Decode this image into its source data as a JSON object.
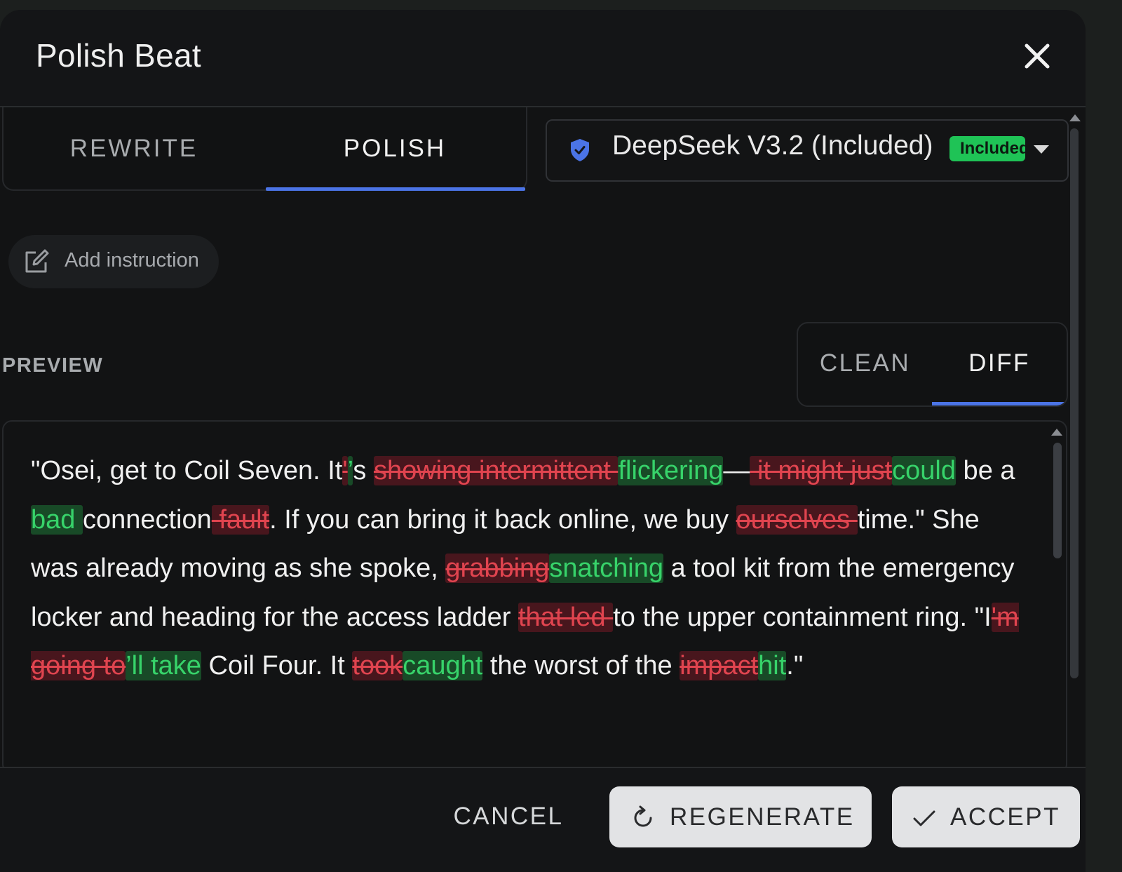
{
  "dialog": {
    "title": "Polish Beat",
    "close_icon": "close-icon"
  },
  "mode_tabs": {
    "items": [
      "REWRITE",
      "POLISH"
    ],
    "active": "POLISH"
  },
  "model": {
    "name": "DeepSeek V3.2 (Included)",
    "badge": "Included",
    "icon": "shield-check-icon",
    "badge_color": "#1fc356"
  },
  "instruction": {
    "label": "Add instruction",
    "icon": "edit-icon"
  },
  "preview": {
    "label": "PREVIEW",
    "view_tabs": [
      "CLEAN",
      "DIFF"
    ],
    "active_view": "DIFF",
    "segments": [
      {
        "t": "eq",
        "s": "\"Osei, get to Coil Seven. It"
      },
      {
        "t": "del",
        "s": "'"
      },
      {
        "t": "ins",
        "s": "’"
      },
      {
        "t": "eq",
        "s": "s "
      },
      {
        "t": "del",
        "s": "showing intermittent "
      },
      {
        "t": "ins",
        "s": "flickering"
      },
      {
        "t": "eq",
        "s": "—"
      },
      {
        "t": "del",
        "s": " it might just"
      },
      {
        "t": "ins",
        "s": "could"
      },
      {
        "t": "eq",
        "s": " be a "
      },
      {
        "t": "ins",
        "s": "bad "
      },
      {
        "t": "eq",
        "s": "connection"
      },
      {
        "t": "del",
        "s": " fault"
      },
      {
        "t": "eq",
        "s": ". If you can bring it back online, we buy "
      },
      {
        "t": "del",
        "s": "ourselves "
      },
      {
        "t": "eq",
        "s": "time.\" She was already moving as she spoke, "
      },
      {
        "t": "del",
        "s": "grabbing"
      },
      {
        "t": "ins",
        "s": "snatching"
      },
      {
        "t": "eq",
        "s": " a tool kit from the emergency locker and heading for the access ladder "
      },
      {
        "t": "del",
        "s": "that led "
      },
      {
        "t": "eq",
        "s": "to the upper containment ring. \"I"
      },
      {
        "t": "del",
        "s": "'m going to"
      },
      {
        "t": "ins",
        "s": "’ll take"
      },
      {
        "t": "eq",
        "s": " Coil Four. It "
      },
      {
        "t": "del",
        "s": "took"
      },
      {
        "t": "ins",
        "s": "caught"
      },
      {
        "t": "eq",
        "s": " the worst of the "
      },
      {
        "t": "del",
        "s": "impact"
      },
      {
        "t": "ins",
        "s": "hit"
      },
      {
        "t": "eq",
        "s": ".\""
      }
    ],
    "colors": {
      "deleted": "#e0444f",
      "inserted": "#37d36a",
      "accent": "#4b74e6"
    }
  },
  "footer": {
    "cancel_label": "CANCEL",
    "regenerate_label": "REGENERATE",
    "regenerate_icon": "refresh-icon",
    "accept_label": "ACCEPT",
    "accept_icon": "check-icon"
  }
}
